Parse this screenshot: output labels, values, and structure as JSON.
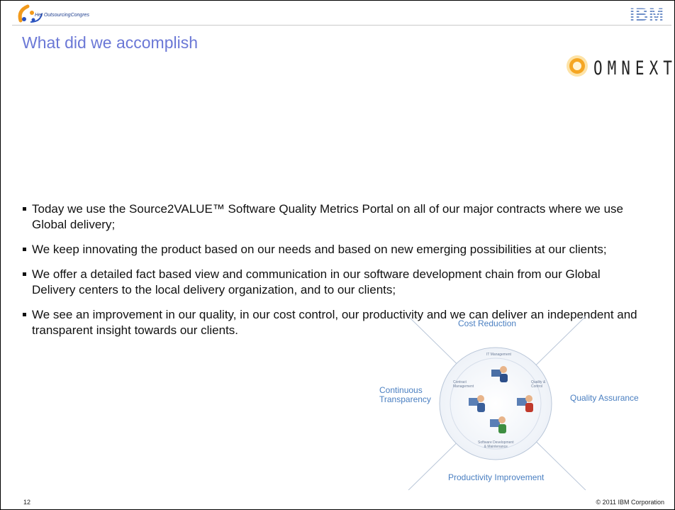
{
  "header": {
    "congress_logo_text": "Het OutsourcingCongres",
    "ibm_logo": "IBM",
    "omnext_logo": "OMNEXT"
  },
  "slide": {
    "title": "What did we accomplish",
    "bullets": [
      "Today we use the Source2VALUE™ Software Quality Metrics Portal on all of our major contracts where we use Global delivery;",
      "We keep innovating the product based on our needs and based on new emerging possibilities at our clients;",
      "We offer a detailed fact based view and communication in our software development chain from our Global Delivery centers to the local delivery organization, and to our clients;",
      "We see an improvement in our quality, in our cost control, our productivity and we can deliver an independent and transparent insight towards our clients."
    ]
  },
  "diagram": {
    "top": "Cost Reduction",
    "right": "Quality Assurance",
    "bottom": "Productivity Improvement",
    "left_line1": "Continuous",
    "left_line2": "Transparency",
    "inner_top": "IT Management",
    "inner_left_line1": "Contract",
    "inner_left_line2": "Management",
    "inner_right_line1": "Quality &",
    "inner_right_line2": "Control",
    "inner_bottom_line1": "Software Development",
    "inner_bottom_line2": "& Maintenance"
  },
  "footer": {
    "page_number": "12",
    "copyright": "© 2011 IBM Corporation"
  },
  "colors": {
    "title": "#6b78d6",
    "diagram_label": "#4a7fc1",
    "ibm_logo": "#6f8fc8",
    "omnext_orange": "#f5a623"
  }
}
